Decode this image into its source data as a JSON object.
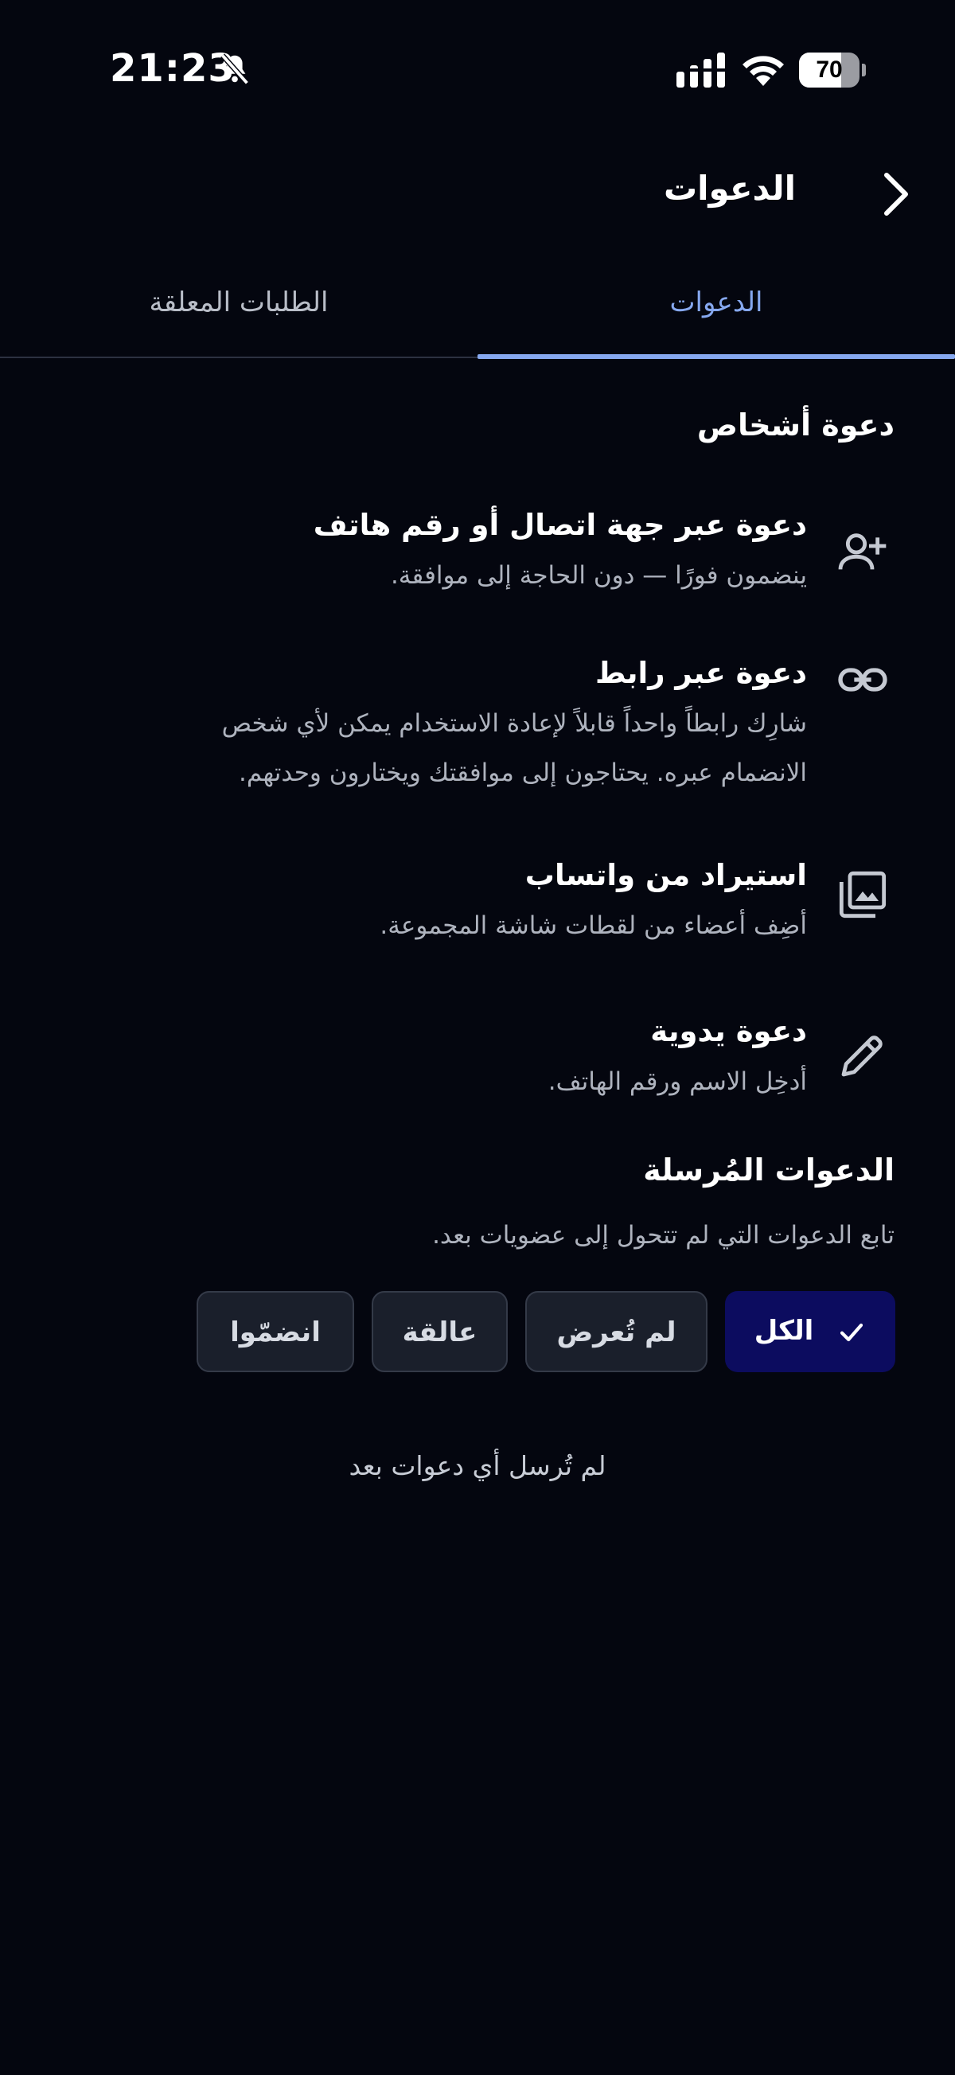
{
  "status_bar": {
    "time": "21:23",
    "battery_level": "70"
  },
  "header": {
    "title": "الدعوات",
    "back_icon": "chevron-right-icon"
  },
  "tabs": [
    {
      "label": "الدعوات",
      "active": true
    },
    {
      "label": "الطلبات المعلقة",
      "active": false
    }
  ],
  "invite_section": {
    "title": "دعوة أشخاص",
    "options": [
      {
        "title": "دعوة عبر جهة اتصال أو رقم هاتف",
        "subtitle": "ينضمون فورًا — دون الحاجة إلى موافقة.",
        "icon": "person-add-icon"
      },
      {
        "title": "دعوة عبر رابط",
        "subtitle": "شارِك رابطاً واحداً قابلاً لإعادة الاستخدام يمكن لأي شخص الانضمام عبره. يحتاجون إلى موافقتك ويختارون وحدتهم.",
        "icon": "link-icon"
      },
      {
        "title": "استيراد من واتساب",
        "subtitle": "أضِف أعضاء من لقطات شاشة المجموعة.",
        "icon": "image-library-icon"
      },
      {
        "title": "دعوة يدوية",
        "subtitle": "أدخِل الاسم ورقم الهاتف.",
        "icon": "pencil-icon"
      }
    ]
  },
  "sent_section": {
    "title": "الدعوات المُرسلة",
    "subtitle": "تابع الدعوات التي لم تتحول إلى عضويات بعد.",
    "filters": [
      {
        "label": "الكل",
        "selected": true
      },
      {
        "label": "لم تُعرض",
        "selected": false
      },
      {
        "label": "عالقة",
        "selected": false
      },
      {
        "label": "انضمّوا",
        "selected": false
      }
    ],
    "empty_message": "لم تُرسل أي دعوات بعد"
  },
  "colors": {
    "background": "#04060f",
    "accent": "#86a8ef",
    "chip_selected": "#0c0c5f"
  }
}
